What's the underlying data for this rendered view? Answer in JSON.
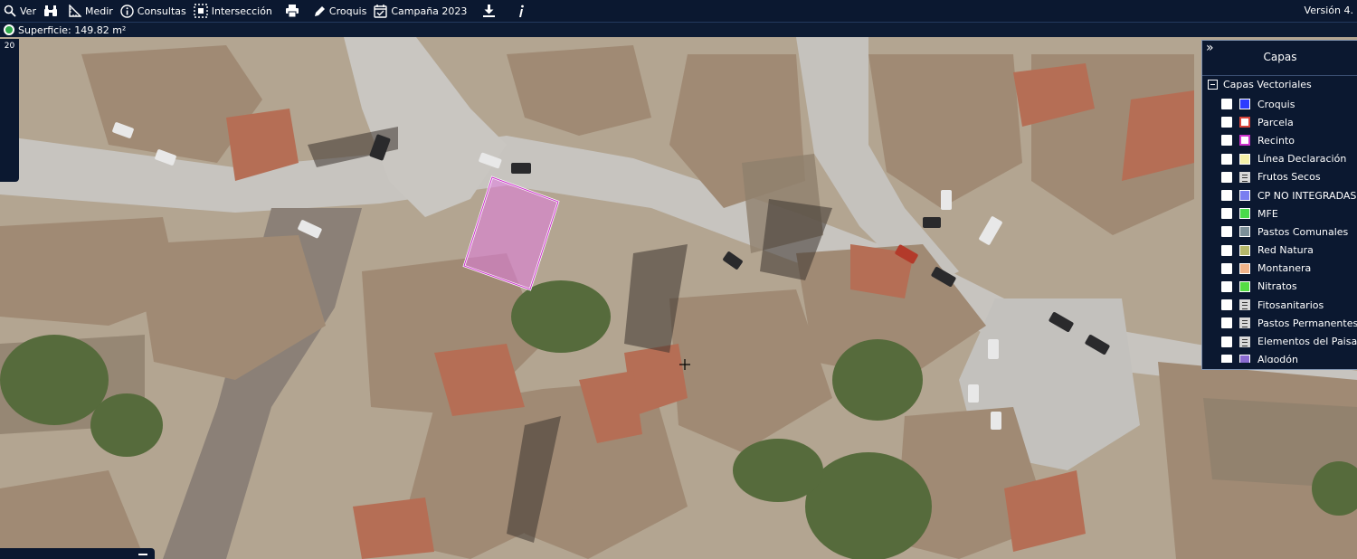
{
  "toolbar": {
    "items": [
      {
        "label": "Ver",
        "icon": "search-icon"
      },
      {
        "label": "",
        "icon": "binoculars-icon"
      },
      {
        "label": "Medir",
        "icon": "ruler-icon"
      },
      {
        "label": "Consultas",
        "icon": "info-icon"
      },
      {
        "label": "Intersección",
        "icon": "intersection-icon"
      },
      {
        "label": "",
        "icon": "printer-icon"
      },
      {
        "label": "Croquis",
        "icon": "pencil-icon"
      },
      {
        "label": "Campaña 2023",
        "icon": "calendar-check-icon"
      },
      {
        "label": "",
        "icon": "download-icon"
      },
      {
        "label": "",
        "icon": "italic-info-icon"
      }
    ],
    "version": "Versión 4."
  },
  "status": {
    "text": "Superficie: 149.82 m²",
    "dot_color": "#2ea84a"
  },
  "zoom": {
    "level": "20"
  },
  "layers": {
    "title": "Capas",
    "collapse": "»",
    "group": "Capas Vectoriales",
    "items": [
      {
        "label": "Croquis",
        "swatch": "#2b3cff",
        "type": "color"
      },
      {
        "label": "Parcela",
        "swatch": "#ffffff",
        "border": "#d8433a",
        "type": "outline"
      },
      {
        "label": "Recinto",
        "swatch": "#ffffff",
        "border": "#cc33cc",
        "type": "outline"
      },
      {
        "label": "Línea Declaración",
        "swatch": "#f4f0a8",
        "type": "color"
      },
      {
        "label": "Frutos Secos",
        "swatch": "#d8d8d8",
        "type": "list"
      },
      {
        "label": "CP NO INTEGRADAS",
        "swatch": "#7a7ef0",
        "type": "color"
      },
      {
        "label": "MFE",
        "swatch": "#4adb4a",
        "type": "color"
      },
      {
        "label": "Pastos Comunales",
        "swatch": "#7b8f98",
        "type": "color"
      },
      {
        "label": "Red Natura",
        "swatch": "#b6b86a",
        "type": "color"
      },
      {
        "label": "Montanera",
        "swatch": "#f2b48a",
        "type": "color"
      },
      {
        "label": "Nitratos",
        "swatch": "#55dd44",
        "type": "color"
      },
      {
        "label": "Fitosanitarios",
        "swatch": "#d8d8d8",
        "type": "list"
      },
      {
        "label": "Pastos Permanentes",
        "swatch": "#d8d8d8",
        "type": "list"
      },
      {
        "label": "Elementos del Paisaje",
        "swatch": "#d8d8d8",
        "type": "list"
      },
      {
        "label": "Algodón",
        "swatch": "#8a6ad0",
        "type": "color"
      }
    ]
  }
}
